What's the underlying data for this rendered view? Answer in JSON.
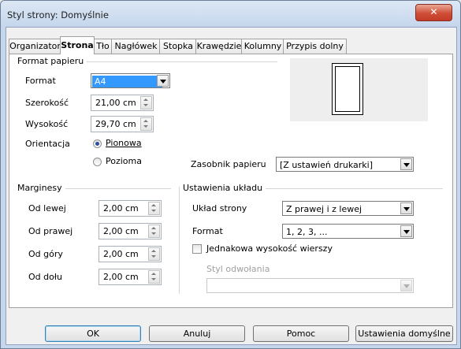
{
  "window": {
    "title": "Styl strony: Domyślnie",
    "close_symbol": "✕"
  },
  "tabs": [
    {
      "label": "Organizator"
    },
    {
      "label": "Strona"
    },
    {
      "label": "Tło"
    },
    {
      "label": "Nagłówek"
    },
    {
      "label": "Stopka"
    },
    {
      "label": "Krawędzie"
    },
    {
      "label": "Kolumny"
    },
    {
      "label": "Przypis dolny"
    }
  ],
  "paper_format": {
    "group_title": "Format papieru",
    "format_label": "Format",
    "format_value": "A4",
    "width_label": "Szerokość",
    "width_value": "21,00 cm",
    "height_label": "Wysokość",
    "height_value": "29,70 cm",
    "orientation_label": "Orientacja",
    "portrait_label": "Pionowa",
    "landscape_label": "Pozioma",
    "orientation_selected": "Pionowa",
    "tray_label": "Zasobnik papieru",
    "tray_value": "[Z ustawień drukarki]"
  },
  "margins": {
    "group_title": "Marginesy",
    "left_label": "Od lewej",
    "left_value": "2,00 cm",
    "right_label": "Od prawej",
    "right_value": "2,00 cm",
    "top_label": "Od góry",
    "top_value": "2,00 cm",
    "bottom_label": "Od dołu",
    "bottom_value": "2,00 cm"
  },
  "layout": {
    "group_title": "Ustawienia układu",
    "page_layout_label": "Układ strony",
    "page_layout_value": "Z prawej i z lewej",
    "format_label": "Format",
    "format_value": "1, 2, 3, ...",
    "register_true_label": "Jednakowa wysokość wierszy",
    "reference_style_label": "Styl odwołania",
    "reference_style_value": ""
  },
  "buttons": {
    "ok": "OK",
    "cancel": "Anuluj",
    "help": "Pomoc",
    "defaults": "Ustawienia domyślne"
  },
  "colors": {
    "accent": "#3399ff",
    "window_frame": "#c6d7ec",
    "close_button": "#c33b26"
  }
}
